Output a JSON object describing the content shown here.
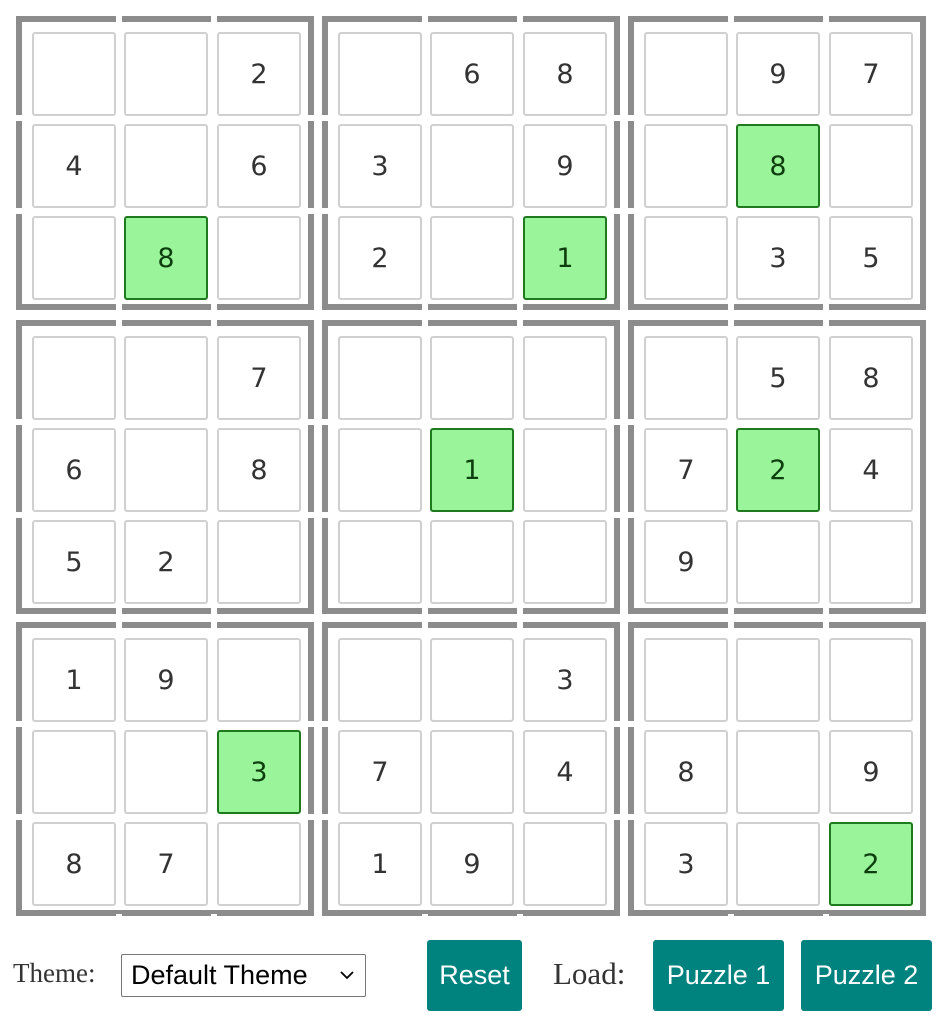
{
  "sudoku": {
    "grid": [
      [
        0,
        0,
        2,
        0,
        6,
        8,
        0,
        9,
        7
      ],
      [
        4,
        0,
        6,
        3,
        0,
        9,
        0,
        8,
        0
      ],
      [
        0,
        8,
        0,
        2,
        0,
        1,
        0,
        3,
        5
      ],
      [
        0,
        0,
        7,
        0,
        0,
        0,
        0,
        5,
        8
      ],
      [
        6,
        0,
        8,
        0,
        1,
        0,
        7,
        2,
        4
      ],
      [
        5,
        2,
        0,
        0,
        0,
        0,
        9,
        0,
        0
      ],
      [
        1,
        9,
        0,
        0,
        0,
        3,
        0,
        0,
        0
      ],
      [
        0,
        0,
        3,
        7,
        0,
        4,
        8,
        0,
        9
      ],
      [
        8,
        7,
        0,
        1,
        9,
        0,
        3,
        0,
        2
      ]
    ],
    "highlighted_cells": [
      [
        1,
        7
      ],
      [
        2,
        1
      ],
      [
        2,
        5
      ],
      [
        4,
        4
      ],
      [
        4,
        7
      ],
      [
        7,
        2
      ],
      [
        8,
        8
      ]
    ],
    "highlight_color": "#9af59a",
    "highlight_border_color": "#1f7a1f",
    "block_border_color": "#8c8c8c"
  },
  "controls": {
    "theme_label": "Theme:",
    "theme_selected": "Default Theme",
    "reset_label": "Reset",
    "load_label": "Load:",
    "puzzle_1_label": "Puzzle 1",
    "puzzle_2_label": "Puzzle 2",
    "button_color": "#00827f"
  }
}
